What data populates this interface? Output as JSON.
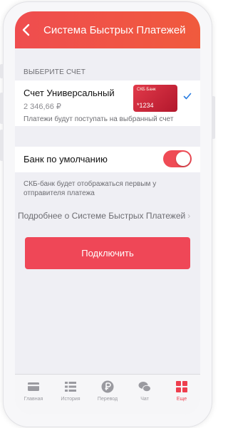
{
  "header": {
    "title": "Система Быстрых Платежей",
    "back_icon": "chevron-left-icon"
  },
  "account_section": {
    "label": "ВЫБЕРИТЕ СЧЕТ",
    "account": {
      "name": "Счет Универсальный",
      "balance": "2 346,66 ₽",
      "card_last4": "*1234",
      "card_brand_text": "СКБ Банк",
      "selected": true
    },
    "hint": "Платежи будут поступать на выбранный счет"
  },
  "default_bank": {
    "label": "Банк по умолчанию",
    "enabled": true,
    "hint": "СКБ-банк будет отображаться первым у отправителя платежа"
  },
  "more_link": {
    "label": "Подробнее о Системе Быстрых Платежей"
  },
  "connect_button": {
    "label": "Подключить"
  },
  "tabbar": {
    "items": [
      {
        "label": "Главная",
        "icon": "card-icon"
      },
      {
        "label": "История",
        "icon": "list-icon"
      },
      {
        "label": "Перевод",
        "icon": "ruble-icon"
      },
      {
        "label": "Чат",
        "icon": "chat-icon"
      },
      {
        "label": "Еще",
        "icon": "grid-icon",
        "active": true
      }
    ]
  },
  "colors": {
    "accent": "#ef4757",
    "header": "#f05244",
    "check": "#2a7de1",
    "background": "#efeff4"
  }
}
